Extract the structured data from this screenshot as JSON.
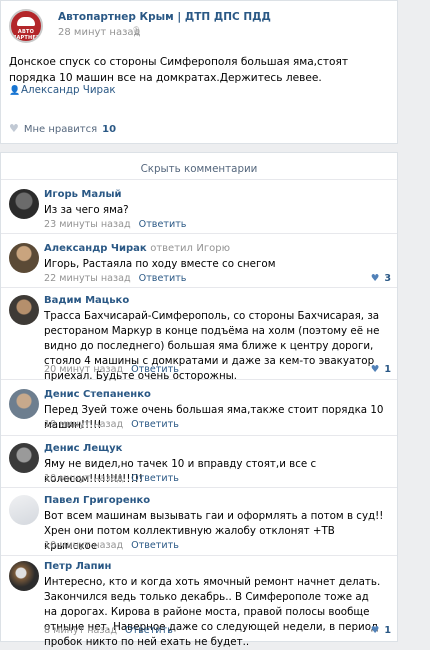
{
  "post": {
    "group_name": "Автопартнер Крым | ДТП ДПС ПДД",
    "logo_text": "АВТО ПАРТНЕР",
    "time": "28 минут назад",
    "text": "Донское спуск со стороны Симферополя большая яма,стоят порядка 10 машин все на домкратах.Держитесь левее.",
    "signer": "Александр Чирак",
    "like_label": "Мне нравится",
    "like_count": "10"
  },
  "comments_block": {
    "hide_label": "Скрыть комментарии",
    "reply_label": "Ответить",
    "replied_word": "ответил",
    "items": [
      {
        "name": "Игорь Малый",
        "reply_to": "",
        "text": "Из за чего яма?",
        "time": "23 минуты назад",
        "likes": ""
      },
      {
        "name": "Александр Чирак",
        "reply_to": "Игорю",
        "text": "Игорь, Растаяла по ходу вместе со снегом",
        "time": "22 минуты назад",
        "likes": "3"
      },
      {
        "name": "Вадим Мацько",
        "reply_to": "",
        "text": "Трасса Бахчисарай-Симферополь, со стороны Бахчисарая, за рестораном Маркур в конце подъёма на холм (поэтому её не видно до последнего) большая яма ближе к центру дороги, стояло 4 машины с домкратами и даже за кем-то эвакуатор приехал. Будьте очень осторожны.",
        "time": "20 минут назад",
        "likes": "1"
      },
      {
        "name": "Денис Степаненко",
        "reply_to": "",
        "text": "Перед Зуей тоже очень большая яма,также стоит порядка 10 машин!!!!!",
        "time": "19 минут назад",
        "likes": ""
      },
      {
        "name": "Денис Лещук",
        "reply_to": "",
        "text": "Яму не видел,но тачек 10 и вправду стоят,и все с колесом!!!!!!!!!!!!!",
        "time": "10 минут назад",
        "likes": ""
      },
      {
        "name": "Павел Григоренко",
        "reply_to": "",
        "text": "Вот всем машинам вызывать гаи и оформлять а потом в суд!! Хрен они потом коллективную жалобу отклонят +ТВ крымское",
        "time": "10 минут назад",
        "likes": ""
      },
      {
        "name": "Петр Лапин",
        "reply_to": "",
        "text": "Интересно, кто и когда хоть ямочный ремонт начнет делать. Закончился ведь только декабрь.. В Симферополе тоже ад на дорогах. Кирова в районе моста, правой полосы вообще отныне нет. Наверное даже со следующей недели, в период пробок никто по ней ехать не будет..",
        "time": "8 минут назад",
        "likes": "1"
      }
    ]
  },
  "colors": {
    "link": "#2a5885",
    "meta": "#939393",
    "background": "#edeef0",
    "logo_red": "#b3262a"
  },
  "icons": {
    "mic": "microphone-icon",
    "person": "person-icon",
    "heart": "heart-icon"
  }
}
